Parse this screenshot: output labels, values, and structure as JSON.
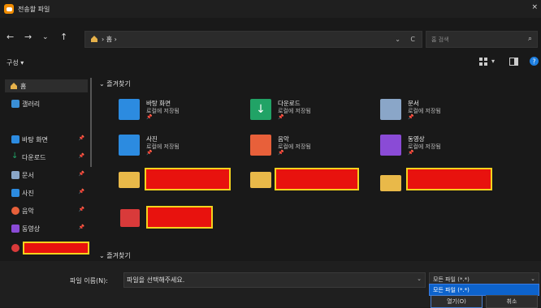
{
  "window": {
    "title": "전송할 파일",
    "close": "×"
  },
  "nav": {
    "back": "←",
    "forward": "→",
    "history": "⌄",
    "up": "↑"
  },
  "address": {
    "path": "› 홈 ›",
    "dropdown": "⌄",
    "refresh": "C"
  },
  "search": {
    "placeholder": "홈 검색",
    "icon": "⌕"
  },
  "toolbar": {
    "organize": "구성 ▾",
    "view_dropdown": "▾"
  },
  "sidebar": {
    "items": [
      {
        "label": "홈",
        "icon": "home-icon",
        "color": "#e6b14a",
        "pinned": false
      },
      {
        "label": "갤러리",
        "icon": "gallery-icon",
        "color": "#3a8fd6",
        "pinned": false
      },
      {
        "label": "바탕 화면",
        "icon": "desktop-icon",
        "color": "#2c8be0",
        "pinned": true
      },
      {
        "label": "다운로드",
        "icon": "download-icon",
        "color": "#21a366",
        "pinned": true
      },
      {
        "label": "문서",
        "icon": "document-icon",
        "color": "#8aa6c8",
        "pinned": true
      },
      {
        "label": "사진",
        "icon": "pictures-icon",
        "color": "#2c8be0",
        "pinned": true
      },
      {
        "label": "음악",
        "icon": "music-icon",
        "color": "#e8603a",
        "pinned": true
      },
      {
        "label": "동영상",
        "icon": "video-icon",
        "color": "#8a4bd6",
        "pinned": true
      }
    ],
    "pin_glyph": "📌"
  },
  "main": {
    "quick_access_header": "⌄ 즐겨찾기",
    "tiles": [
      {
        "name": "바탕 화면",
        "sub": "로컬에 저장됨",
        "pin": "📌",
        "icon": "desktop-folder-icon",
        "color": "#2c8be0"
      },
      {
        "name": "다운로드",
        "sub": "로컬에 저장됨",
        "pin": "📌",
        "icon": "download-folder-icon",
        "color": "#21a366"
      },
      {
        "name": "문서",
        "sub": "로컬에 저장됨",
        "pin": "📌",
        "icon": "document-folder-icon",
        "color": "#8aa6c8"
      },
      {
        "name": "사진",
        "sub": "로컬에 저장됨",
        "pin": "📌",
        "icon": "pictures-folder-icon",
        "color": "#2c8be0"
      },
      {
        "name": "음악",
        "sub": "로컬에 저장됨",
        "pin": "📌",
        "icon": "music-folder-icon",
        "color": "#e8603a"
      },
      {
        "name": "동영상",
        "sub": "로컬에 저장됨",
        "pin": "📌",
        "icon": "video-folder-icon",
        "color": "#8a4bd6"
      }
    ],
    "favorites_header": "⌄ 즐겨찾기"
  },
  "bottom": {
    "filename_label": "파일 이름(N):",
    "filename_value": "파일을 선택해주세요.",
    "filetype_value": "모든 파일 (*.*)",
    "filetype_option": "모든 파일 (*.*)",
    "open_label": "열기(O)",
    "cancel_label": "취소"
  },
  "colors": {
    "redact_fill": "#e8120e",
    "redact_border": "#f4d21d",
    "accent": "#0d63cc"
  }
}
